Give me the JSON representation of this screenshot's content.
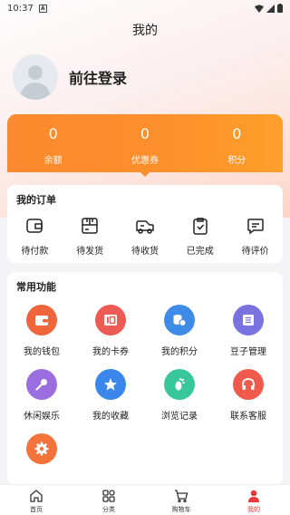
{
  "status_bar": {
    "time": "10:37",
    "notification_icon": "A"
  },
  "header": {
    "title": "我的"
  },
  "profile": {
    "login_label": "前往登录"
  },
  "stats": [
    {
      "value": "0",
      "label": "余额"
    },
    {
      "value": "0",
      "label": "优惠券"
    },
    {
      "value": "0",
      "label": "积分"
    }
  ],
  "orders": {
    "title": "我的订单",
    "items": [
      {
        "label": "待付款",
        "icon": "wallet-icon"
      },
      {
        "label": "待发货",
        "icon": "package-icon"
      },
      {
        "label": "待收货",
        "icon": "truck-icon"
      },
      {
        "label": "已完成",
        "icon": "clipboard-check-icon"
      },
      {
        "label": "待评价",
        "icon": "comment-icon"
      }
    ]
  },
  "features": {
    "title": "常用功能",
    "items": [
      {
        "label": "我的钱包",
        "icon": "wallet-icon",
        "color": "#f0663c"
      },
      {
        "label": "我的卡券",
        "icon": "coupon-icon",
        "color": "#ee5a54"
      },
      {
        "label": "我的积分",
        "icon": "coins-icon",
        "color": "#3f8be8"
      },
      {
        "label": "豆子管理",
        "icon": "list-icon",
        "color": "#7a72e0"
      },
      {
        "label": "休闲娱乐",
        "icon": "microphone-icon",
        "color": "#9b6ee0"
      },
      {
        "label": "我的收藏",
        "icon": "star-icon",
        "color": "#3a86ea"
      },
      {
        "label": "浏览记录",
        "icon": "footprint-icon",
        "color": "#37c79a"
      },
      {
        "label": "联系客服",
        "icon": "headphones-icon",
        "color": "#ef5a4c"
      },
      {
        "label": "",
        "icon": "settings-icon",
        "color": "#f3733a"
      }
    ]
  },
  "tabbar": {
    "active_color": "#e83a3a",
    "items": [
      {
        "label": "首页",
        "icon": "home-icon"
      },
      {
        "label": "分类",
        "icon": "category-icon"
      },
      {
        "label": "购物车",
        "icon": "cart-icon"
      },
      {
        "label": "我的",
        "icon": "user-icon",
        "active": true
      }
    ]
  }
}
